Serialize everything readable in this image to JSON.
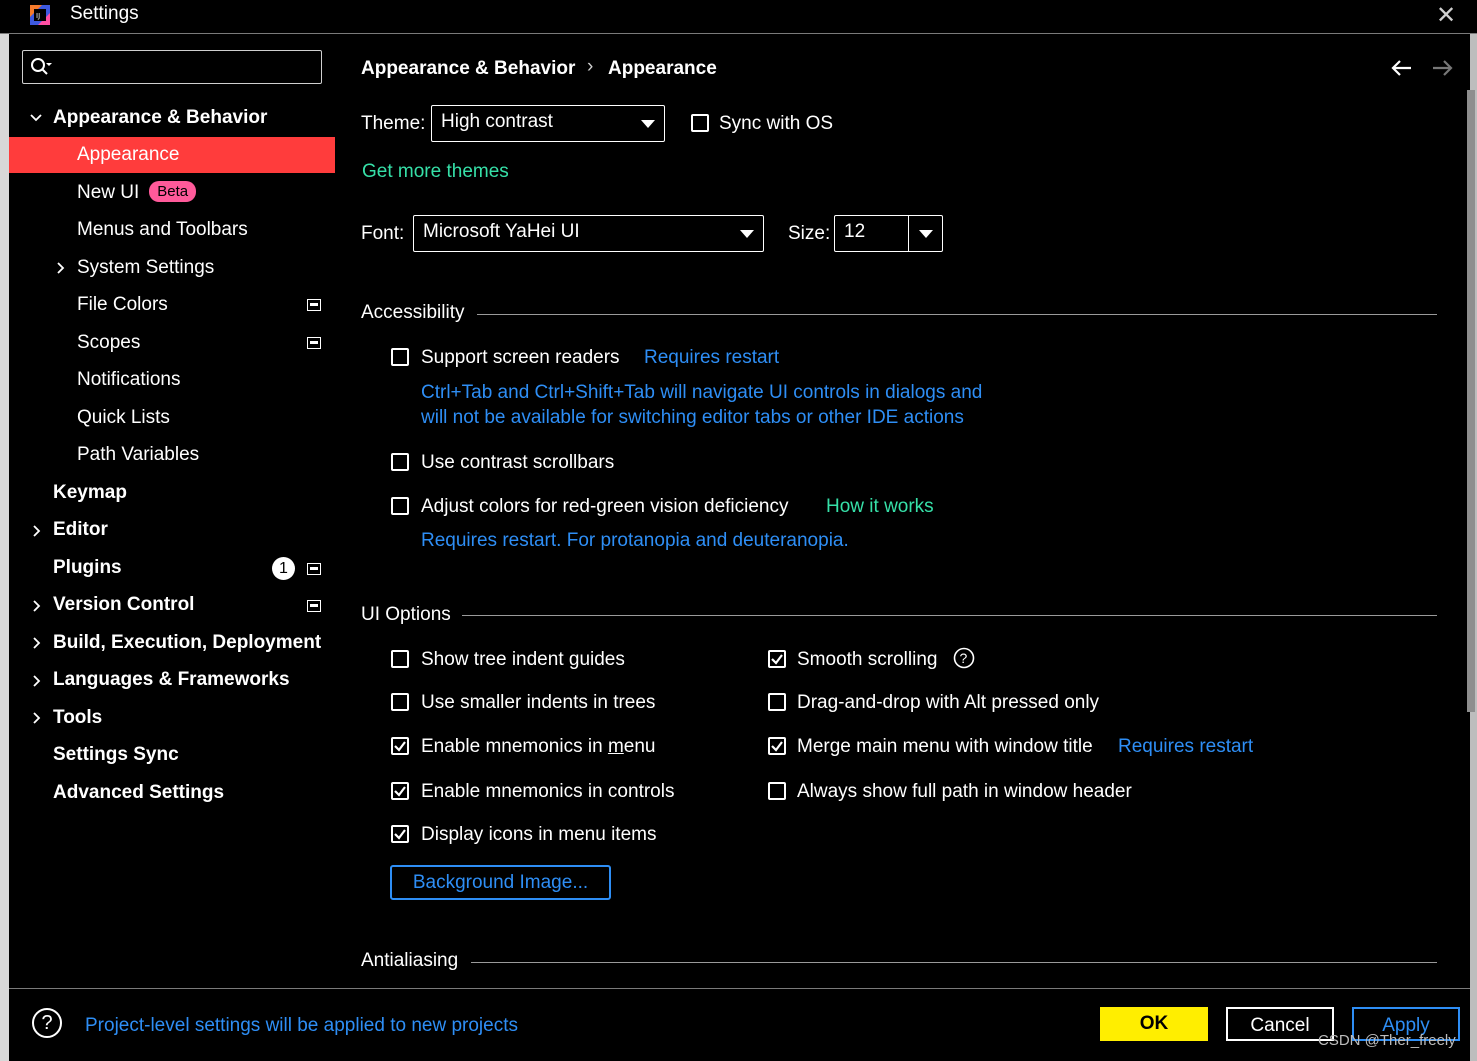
{
  "window": {
    "title": "Settings",
    "close_glyph": "✕"
  },
  "sidebar": {
    "search": {
      "placeholder": ""
    },
    "items": [
      {
        "label": "Appearance & Behavior"
      },
      {
        "label": "Appearance"
      },
      {
        "label": "New UI",
        "badge": "Beta"
      },
      {
        "label": "Menus and Toolbars"
      },
      {
        "label": "System Settings"
      },
      {
        "label": "File Colors"
      },
      {
        "label": "Scopes"
      },
      {
        "label": "Notifications"
      },
      {
        "label": "Quick Lists"
      },
      {
        "label": "Path Variables"
      },
      {
        "label": "Keymap"
      },
      {
        "label": "Editor"
      },
      {
        "label": "Plugins",
        "count": "1"
      },
      {
        "label": "Version Control"
      },
      {
        "label": "Build, Execution, Deployment"
      },
      {
        "label": "Languages & Frameworks"
      },
      {
        "label": "Tools"
      },
      {
        "label": "Settings Sync"
      },
      {
        "label": "Advanced Settings"
      }
    ]
  },
  "breadcrumb": {
    "parent": "Appearance & Behavior",
    "separator": "›",
    "current": "Appearance"
  },
  "theme": {
    "label": "Theme:",
    "value": "High contrast",
    "sync_label": "Sync with OS",
    "more_link": "Get more themes"
  },
  "font": {
    "label": "Font:",
    "value": "Microsoft YaHei UI",
    "size_label": "Size:",
    "size_value": "12"
  },
  "accessibility": {
    "header": "Accessibility",
    "screen_readers": "Support screen readers",
    "requires_restart": "Requires restart",
    "screen_readers_note_1": "Ctrl+Tab and Ctrl+Shift+Tab will navigate UI controls in dialogs and",
    "screen_readers_note_2": "will not be available for switching editor tabs or other IDE actions",
    "contrast_scrollbars": "Use contrast scrollbars",
    "red_green": "Adjust colors for red-green vision deficiency",
    "how_it_works": "How it works",
    "red_green_note": "Requires restart. For protanopia and deuteranopia."
  },
  "ui_options": {
    "header": "UI Options",
    "tree_indent": "Show tree indent guides",
    "smaller_indents": "Use smaller indents in trees",
    "mnemonics_menu_pre": "Enable mnemonics in ",
    "mnemonics_menu_key": "m",
    "mnemonics_menu_post": "enu",
    "mnemonics_controls": "Enable mnemonics in controls",
    "icons_menu": "Display icons in menu items",
    "background_image": "Background Image...",
    "smooth_scrolling": "Smooth scrolling",
    "drag_drop": "Drag-and-drop with Alt pressed only",
    "merge_menu": "Merge main menu with window title",
    "merge_restart": "Requires restart",
    "full_path": "Always show full path in window header"
  },
  "antialiasing": {
    "header": "Antialiasing"
  },
  "footer": {
    "help_glyph": "?",
    "note": "Project-level settings will be applied to new projects",
    "ok": "OK",
    "cancel": "Cancel",
    "apply": "Apply",
    "watermark": "CSDN @Ther_freely"
  },
  "colors": {
    "selection": "#ff3c3c",
    "link": "#2e8ef5",
    "link_green": "#36e0a8",
    "ok_button": "#ffee00",
    "beta_badge": "#ff5a9a"
  }
}
